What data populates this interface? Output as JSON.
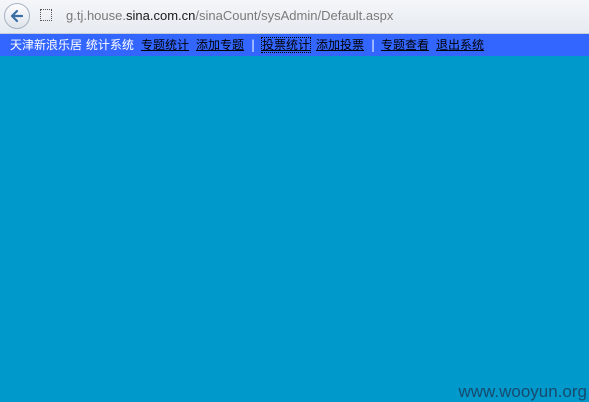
{
  "browser": {
    "url_prefix": "g.tj.house.",
    "url_domain": "sina.com.cn",
    "url_path": "/sinaCount/sysAdmin/Default.aspx"
  },
  "navbar": {
    "brand": "天津新浪乐居 统计系统",
    "links": [
      "专题统计",
      "添加专题",
      "投票统计",
      "添加投票",
      "专题查看",
      "退出系统"
    ],
    "separator": "|"
  },
  "watermark": "www.wooyun.org",
  "colors": {
    "page_bg": "#0099cc",
    "navbar_bg": "#3366ff"
  },
  "icons": {
    "back": "back-arrow-icon",
    "site": "page-icon"
  }
}
